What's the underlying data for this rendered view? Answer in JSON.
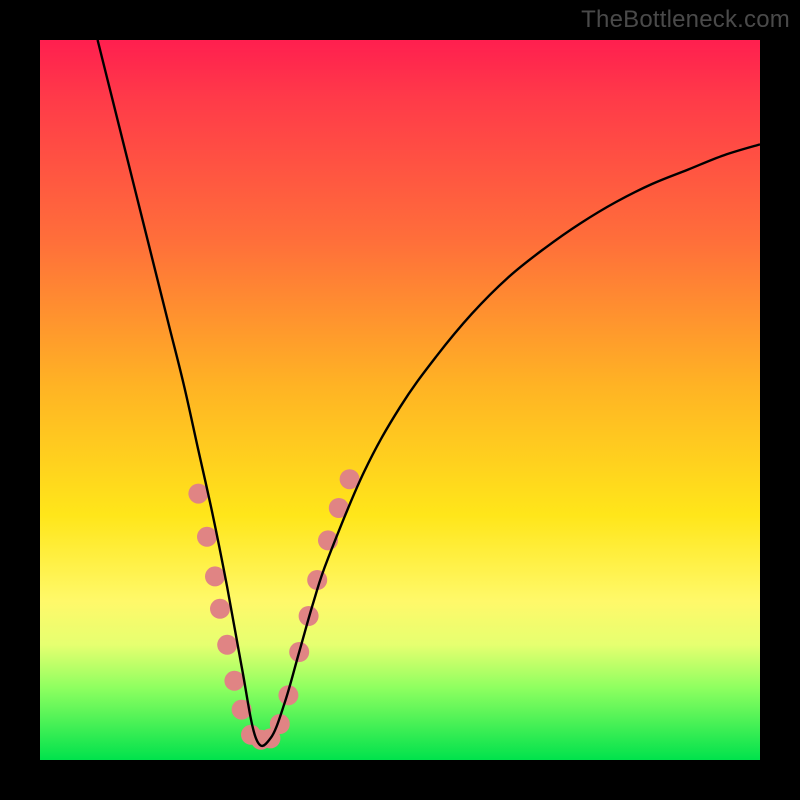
{
  "watermark": "TheBottleneck.com",
  "colors": {
    "curve_stroke": "#000000",
    "dot_fill": "#e08484",
    "background_black": "#000000"
  },
  "chart_data": {
    "type": "line",
    "title": "",
    "xlabel": "",
    "ylabel": "",
    "xlim": [
      0,
      100
    ],
    "ylim": [
      0,
      100
    ],
    "note": "Axes are unlabeled; values are normalized 0–100 from pixel positions. Curve is a V-shaped bottleneck profile with minimum near x≈30.",
    "series": [
      {
        "name": "bottleneck-curve",
        "x": [
          8,
          10,
          12,
          14,
          16,
          18,
          20,
          22,
          24,
          26,
          28,
          30,
          32,
          34,
          36,
          38,
          40,
          45,
          50,
          55,
          60,
          65,
          70,
          75,
          80,
          85,
          90,
          95,
          100
        ],
        "y": [
          100,
          92,
          84,
          76,
          68,
          60,
          52,
          43,
          34,
          24,
          13,
          3,
          3,
          8,
          15,
          22,
          28,
          40,
          49,
          56,
          62,
          67,
          71,
          74.5,
          77.5,
          80,
          82,
          84,
          85.5
        ]
      }
    ],
    "dots": {
      "name": "highlight-dots",
      "points": [
        {
          "x": 22.0,
          "y": 37.0
        },
        {
          "x": 23.2,
          "y": 31.0
        },
        {
          "x": 24.3,
          "y": 25.5
        },
        {
          "x": 25.0,
          "y": 21.0
        },
        {
          "x": 26.0,
          "y": 16.0
        },
        {
          "x": 27.0,
          "y": 11.0
        },
        {
          "x": 28.0,
          "y": 7.0
        },
        {
          "x": 29.3,
          "y": 3.5
        },
        {
          "x": 30.7,
          "y": 2.8
        },
        {
          "x": 32.0,
          "y": 3.0
        },
        {
          "x": 33.3,
          "y": 5.0
        },
        {
          "x": 34.5,
          "y": 9.0
        },
        {
          "x": 36.0,
          "y": 15.0
        },
        {
          "x": 37.3,
          "y": 20.0
        },
        {
          "x": 38.5,
          "y": 25.0
        },
        {
          "x": 40.0,
          "y": 30.5
        },
        {
          "x": 41.5,
          "y": 35.0
        },
        {
          "x": 43.0,
          "y": 39.0
        }
      ],
      "radius_px": 10
    }
  }
}
